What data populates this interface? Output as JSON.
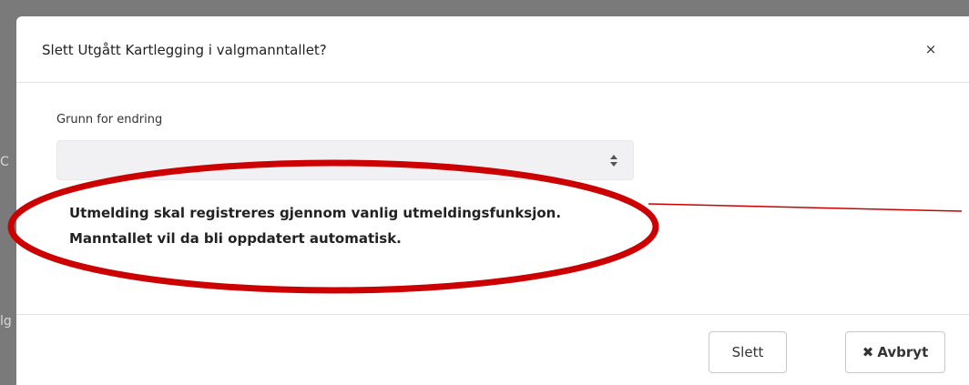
{
  "background": {
    "fragments": [
      "C",
      "lg"
    ]
  },
  "modal": {
    "title": "Slett Utgått Kartlegging i valgmanntallet?",
    "close_label": "×",
    "field": {
      "label": "Grunn for endring",
      "selected_value": ""
    },
    "info_lines": [
      "Utmelding skal registreres gjennom vanlig utmeldingsfunksjon.",
      "Manntallet vil da bli oppdatert automatisk."
    ],
    "buttons": {
      "delete_label": "Slett",
      "cancel_icon": "×-icon",
      "cancel_label": "Avbryt"
    }
  },
  "colors": {
    "annotation": "#cc0000",
    "select_bg": "#f1f1f3",
    "backdrop": "#7a7a7a"
  }
}
